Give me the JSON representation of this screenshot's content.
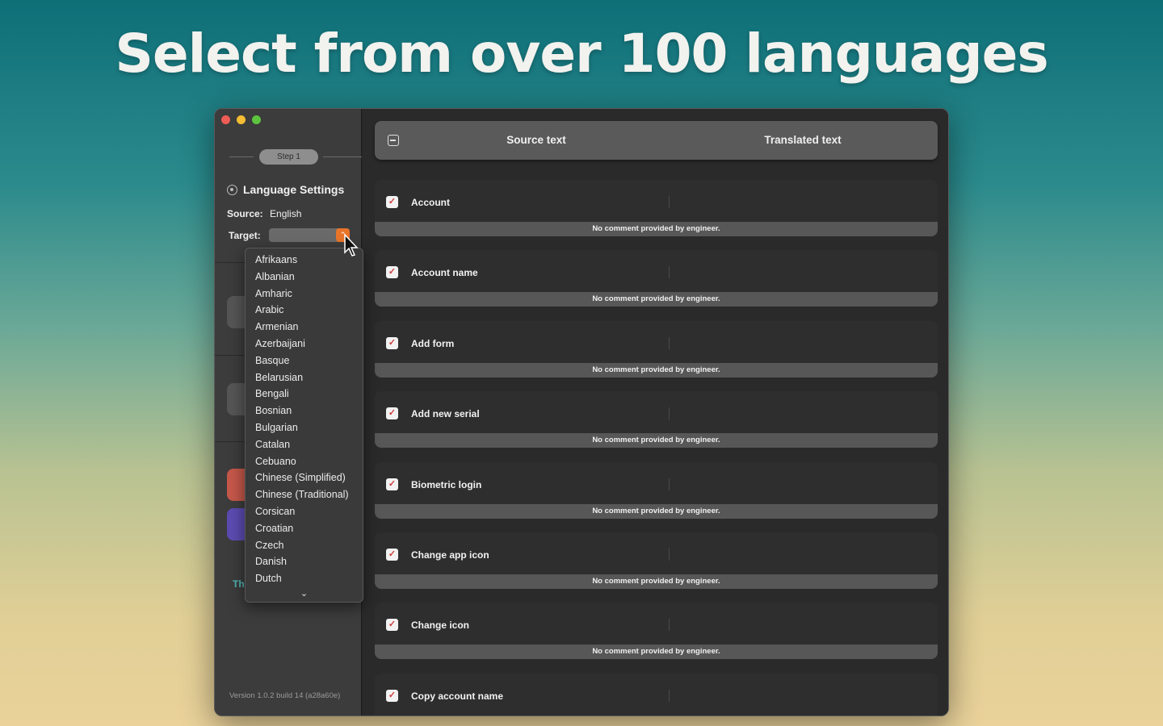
{
  "headline": "Select from over 100 languages",
  "sidebar": {
    "step": "Step 1",
    "section_title": "Language Settings",
    "source_label": "Source:",
    "source_value": "English",
    "target_label": "Target:",
    "teal_text": "Th",
    "version": "Version 1.0.2 build 14 (a28a60e)"
  },
  "dropdown": {
    "options": [
      "Afrikaans",
      "Albanian",
      "Amharic",
      "Arabic",
      "Armenian",
      "Azerbaijani",
      "Basque",
      "Belarusian",
      "Bengali",
      "Bosnian",
      "Bulgarian",
      "Catalan",
      "Cebuano",
      "Chinese (Simplified)",
      "Chinese (Traditional)",
      "Corsican",
      "Croatian",
      "Czech",
      "Danish",
      "Dutch"
    ],
    "more_icon": "chevron-down-icon"
  },
  "table": {
    "header_source": "Source text",
    "header_translated": "Translated text",
    "rows": [
      {
        "source": "Account",
        "comment": "No comment provided by engineer."
      },
      {
        "source": "Account name",
        "comment": "No comment provided by engineer."
      },
      {
        "source": "Add form",
        "comment": "No comment provided by engineer."
      },
      {
        "source": "Add new serial",
        "comment": "No comment provided by engineer."
      },
      {
        "source": "Biometric login",
        "comment": "No comment provided by engineer."
      },
      {
        "source": "Change app icon",
        "comment": "No comment provided by engineer."
      },
      {
        "source": "Change icon",
        "comment": "No comment provided by engineer."
      },
      {
        "source": "Copy account name",
        "comment": "No comment provided by engineer."
      }
    ]
  },
  "colors": {
    "accent": "#e8742a",
    "checkmark": "#d23a3a",
    "teal": "#4fb5b0"
  }
}
